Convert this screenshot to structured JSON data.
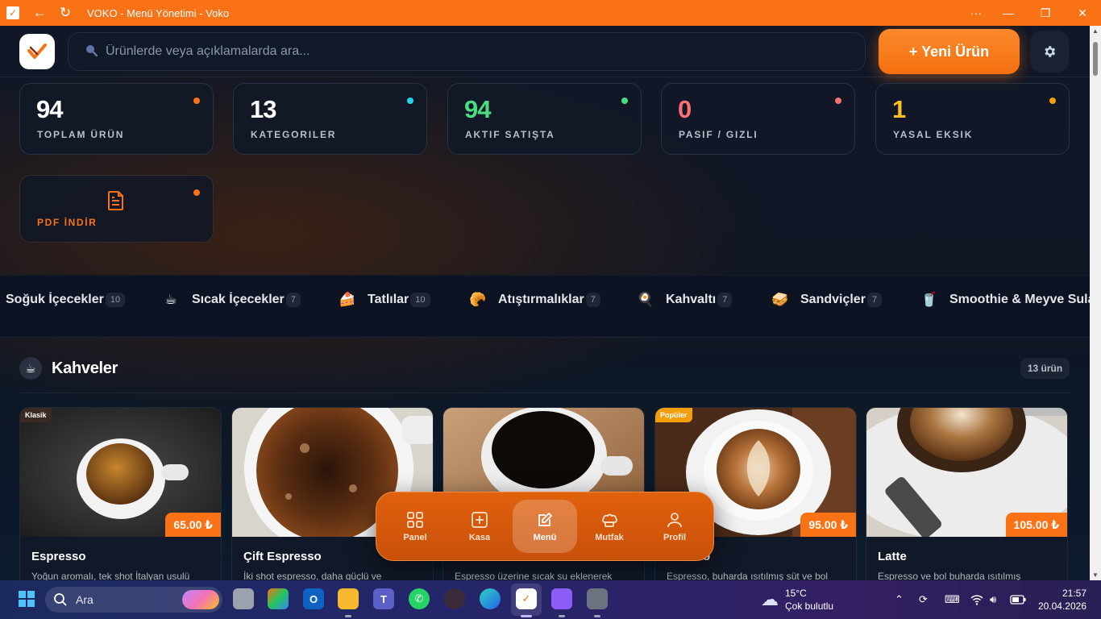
{
  "window": {
    "title": "VOKO - Menü Yönetimi - Voko",
    "minimize": "—",
    "maximize": "❐",
    "close": "✕",
    "more": "···"
  },
  "header": {
    "search_placeholder": "Ürünlerde veya açıklamalarda ara...",
    "new_product_label": "+ Yeni Ürün"
  },
  "stats": [
    {
      "value": "94",
      "label": "TOPLAM ÜRÜN",
      "color": "#ffffff",
      "dot": "#f97316"
    },
    {
      "value": "13",
      "label": "KATEGORILER",
      "color": "#ffffff",
      "dot": "#22d3ee"
    },
    {
      "value": "94",
      "label": "AKTIF SATIŞTA",
      "color": "#4ade80",
      "dot": "#4ade80"
    },
    {
      "value": "0",
      "label": "PASIF / GIZLI",
      "color": "#f87171",
      "dot": "#f87171"
    },
    {
      "value": "1",
      "label": "YASAL EKSIK",
      "color": "#fbbf24",
      "dot": "#f59e0b"
    }
  ],
  "pdf_label": "PDF İNDİR",
  "categories": [
    {
      "name": "Soğuk İçecekler",
      "count": "10",
      "icon": ""
    },
    {
      "name": "Sıcak İçecekler",
      "count": "7",
      "icon": "hot-drink-icon"
    },
    {
      "name": "Tatlılar",
      "count": "10",
      "icon": "cake-icon"
    },
    {
      "name": "Atıştırmalıklar",
      "count": "7",
      "icon": "croissant-icon"
    },
    {
      "name": "Kahvaltı",
      "count": "7",
      "icon": "breakfast-icon"
    },
    {
      "name": "Sandviçler",
      "count": "7",
      "icon": "sandwich-icon"
    },
    {
      "name": "Smoothie & Meyve Sula",
      "count": "",
      "icon": "smoothie-icon"
    }
  ],
  "section": {
    "title": "Kahveler",
    "count": "13 ürün"
  },
  "products": [
    {
      "name": "Espresso",
      "desc": "Yoğun aromalı, tek shot İtalyan usulü",
      "price": "65.00 ₺",
      "badge": "Klasik",
      "badge_color": "#3b2a22"
    },
    {
      "name": "Çift Espresso",
      "desc": "İki shot espresso, daha güçlü ve",
      "price": "",
      "badge": ""
    },
    {
      "name": "",
      "desc": "Espresso üzerine sıcak su eklenerek",
      "price": "",
      "badge": ""
    },
    {
      "name": "…ccino",
      "desc": "Espresso, buharda ısıtılmış süt ve bol",
      "price": "95.00 ₺",
      "badge": "Popüler",
      "badge_color": "#f59e0b"
    },
    {
      "name": "Latte",
      "desc": "Espresso ve bol buharda ısıtılmış",
      "price": "105.00 ₺",
      "badge": ""
    }
  ],
  "bottom_nav": [
    {
      "label": "Panel",
      "icon": "grid-icon"
    },
    {
      "label": "Kasa",
      "icon": "pos-icon"
    },
    {
      "label": "Menü",
      "icon": "edit-icon",
      "active": true
    },
    {
      "label": "Mutfak",
      "icon": "chef-hat-icon"
    },
    {
      "label": "Profil",
      "icon": "user-icon"
    }
  ],
  "taskbar": {
    "search_label": "Ara",
    "weather_temp": "15°C",
    "weather_desc": "Çok bulutlu",
    "time": "21:57",
    "date": "20.04.2026"
  }
}
